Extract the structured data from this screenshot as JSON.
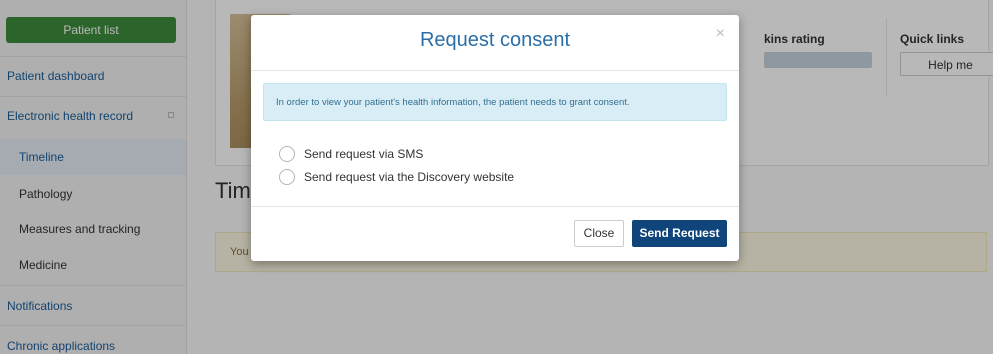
{
  "sidebar": {
    "patient_list_label": "Patient list",
    "items": [
      {
        "label": "Patient dashboard"
      },
      {
        "label": "Electronic health record"
      },
      {
        "label": "Timeline"
      },
      {
        "label": "Pathology"
      },
      {
        "label": "Measures and tracking"
      },
      {
        "label": "Medicine"
      },
      {
        "label": "Notifications"
      },
      {
        "label": "Chronic applications"
      }
    ]
  },
  "main": {
    "rating_title": "kins rating",
    "quick_links_title": "Quick links",
    "help_label": "Help me",
    "page_title": "Tim",
    "alert_text": "You"
  },
  "modal": {
    "title": "Request consent",
    "close_x": "×",
    "info": "In order to view your patient's health information, the patient needs to grant consent.",
    "options": [
      {
        "label": "Send request via SMS"
      },
      {
        "label": "Send request via the Discovery website"
      }
    ],
    "close_label": "Close",
    "send_label": "Send Request"
  },
  "colors": {
    "primary_button": "#10457b",
    "patient_list_button": "#3d8c3d",
    "title_blue": "#2a6fa8",
    "info_bg": "#d9edf7"
  }
}
